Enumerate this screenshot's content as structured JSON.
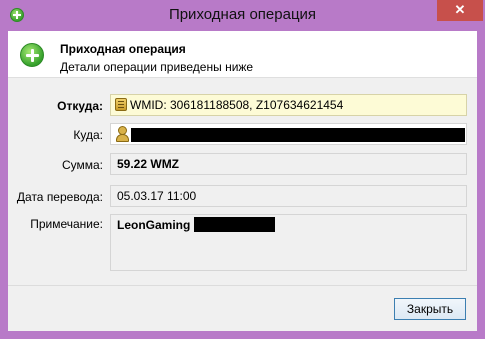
{
  "window": {
    "title": "Приходная операция",
    "close_label": "✕"
  },
  "header": {
    "title": "Приходная операция",
    "subtitle": "Детали операции приведены ниже"
  },
  "fields": {
    "from_label": "Откуда:",
    "from_value": "WMID: 306181188508, Z107634621454",
    "to_label": "Куда:",
    "amount_label": "Сумма:",
    "amount_value": "59.22 WMZ",
    "date_label": "Дата перевода:",
    "date_value": "05.03.17 11:00",
    "note_label": "Примечание:",
    "note_value": "LeonGaming"
  },
  "buttons": {
    "close": "Закрыть"
  },
  "icons": {
    "title": "plus-circle-icon",
    "header": "plus-circle-icon",
    "from": "wallet-icon",
    "to": "user-icon"
  },
  "colors": {
    "titlebar": "#b87ac8",
    "close": "#c7504b",
    "accent": "#3c7fb1",
    "highlight": "#fdfbd6"
  }
}
